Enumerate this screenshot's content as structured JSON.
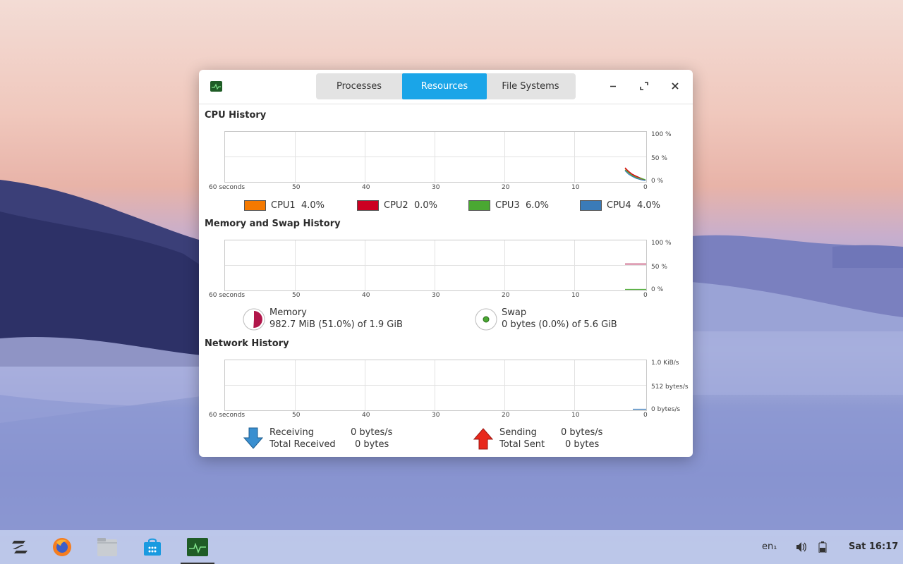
{
  "window": {
    "tabs": [
      {
        "label": "Processes",
        "active": false
      },
      {
        "label": "Resources",
        "active": true
      },
      {
        "label": "File Systems",
        "active": false
      }
    ]
  },
  "cpu": {
    "title": "CPU History",
    "x_ticks": [
      "60 seconds",
      "50",
      "40",
      "30",
      "20",
      "10",
      "0"
    ],
    "y_ticks": [
      "100 %",
      "50 %",
      "0 %"
    ],
    "legend": [
      {
        "name": "CPU1",
        "value": "4.0%",
        "color": "#f57900"
      },
      {
        "name": "CPU2",
        "value": "0.0%",
        "color": "#cc0022"
      },
      {
        "name": "CPU3",
        "value": "6.0%",
        "color": "#4aa832"
      },
      {
        "name": "CPU4",
        "value": "4.0%",
        "color": "#3a7bb8"
      }
    ]
  },
  "memory": {
    "title": "Memory and Swap History",
    "x_ticks": [
      "60 seconds",
      "50",
      "40",
      "30",
      "20",
      "10",
      "0"
    ],
    "y_ticks": [
      "100 %",
      "50 %",
      "0 %"
    ],
    "mem_label": "Memory",
    "mem_value": "982.7 MiB (51.0%) of 1.9 GiB",
    "mem_fraction": 0.51,
    "mem_color": "#b1164a",
    "swap_label": "Swap",
    "swap_value": "0 bytes (0.0%) of 5.6 GiB",
    "swap_fraction": 0.0,
    "swap_color": "#4aa832"
  },
  "network": {
    "title": "Network History",
    "x_ticks": [
      "60 seconds",
      "50",
      "40",
      "30",
      "20",
      "10",
      "0"
    ],
    "y_ticks": [
      "1.0 KiB/s",
      "512 bytes/s",
      "0 bytes/s"
    ],
    "receiving_label": "Receiving",
    "receiving_value": "0 bytes/s",
    "total_received_label": "Total Received",
    "total_received_value": "0 bytes",
    "sending_label": "Sending",
    "sending_value": "0 bytes/s",
    "total_sent_label": "Total Sent",
    "total_sent_value": "0 bytes"
  },
  "taskbar": {
    "icons": [
      "zorin-menu-icon",
      "firefox-icon",
      "files-icon",
      "software-store-icon",
      "system-monitor-icon"
    ],
    "keyboard_layout": "en₁",
    "clock": "Sat 16:17"
  }
}
